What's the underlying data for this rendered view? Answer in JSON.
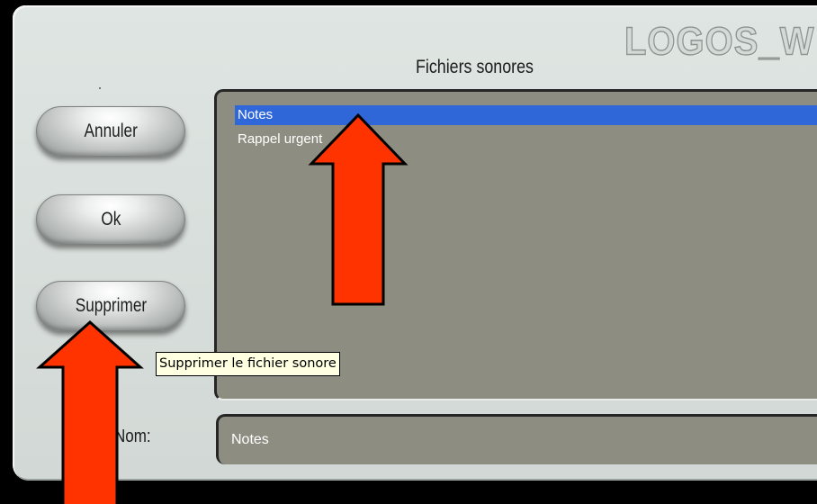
{
  "app": {
    "logo": "LOGOS_W"
  },
  "dialog": {
    "title": "Fichiers sonores"
  },
  "buttons": {
    "cancel": "Annuler",
    "ok": "Ok",
    "delete": "Supprimer"
  },
  "list": {
    "items": [
      {
        "label": "Notes",
        "selected": true
      },
      {
        "label": "Rappel urgent",
        "selected": false
      }
    ]
  },
  "tooltip": {
    "text": "Supprimer le fichier sonore"
  },
  "name": {
    "label": "Nom:",
    "value": "Notes"
  },
  "annotations": {
    "arrow_color": "#ff3300",
    "arrow_outline": "#000000"
  },
  "colors": {
    "selection": "#2f66d8",
    "list_bg": "#8d8e81",
    "panel_bg": "#d8dedb"
  }
}
